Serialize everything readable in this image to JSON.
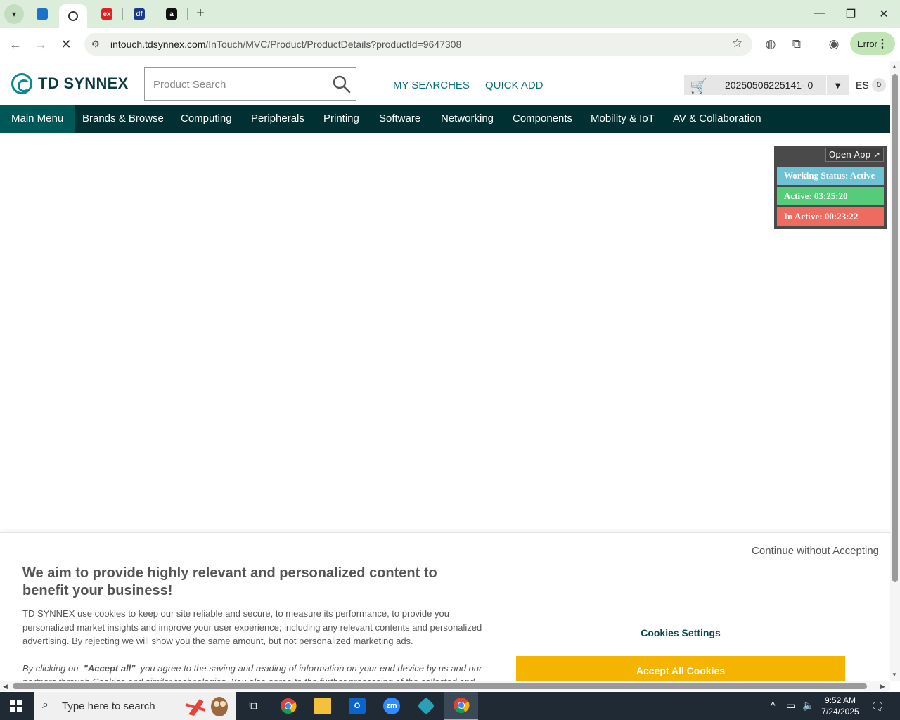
{
  "browser": {
    "tabs": [
      {
        "icon": "tab-favicon-blue",
        "color": "#1a73c9"
      },
      {
        "icon": "tab-favicon-tdsynnex",
        "color": "#3a3a3a",
        "active": true
      },
      {
        "icon": "tab-favicon-ex",
        "color": "#e02020",
        "text": "ex"
      },
      {
        "icon": "tab-favicon-df",
        "color": "#1a3a8a",
        "text": "df"
      },
      {
        "icon": "tab-favicon-amazon",
        "color": "#111111",
        "text": "a"
      }
    ],
    "url_host": "intouch.tdsynnex.com",
    "url_path": "/InTouch/MVC/Product/ProductDetails?productId=9647308",
    "error_label": "Error"
  },
  "header": {
    "logo_text": "TD SYNNEX",
    "search_placeholder": "Product Search",
    "my_searches": "MY SEARCHES",
    "quick_add": "QUICK ADD",
    "cart_label": "20250506225141- 0",
    "lang": "ES",
    "lang_count": "0"
  },
  "nav": {
    "items": [
      "Main Menu",
      "Brands & Browse",
      "Computing",
      "Peripherals",
      "Printing",
      "Software",
      "Networking",
      "Components",
      "Mobility & IoT",
      "AV & Collaboration"
    ]
  },
  "status_widget": {
    "open_app": "Open App ↗",
    "working_status": "Working Status: Active",
    "active": "Active: 03:25:20",
    "inactive": "In Active: 00:23:22",
    "colors": {
      "working": "#6cc3d5",
      "active": "#56cc7a",
      "inactive": "#ee6b5f"
    }
  },
  "cookie_banner": {
    "continue_without": "Continue without Accepting",
    "title": "We aim to provide highly relevant and personalized content to benefit your business!",
    "body": "TD SYNNEX use cookies to keep our site reliable and secure, to measure its performance, to provide you personalized market insights and improve your user experience; including any relevant contents and personalized advertising. By rejecting we will show you the same amount, but not personalized marketing ads.",
    "consent_prefix": "By clicking on",
    "consent_emph": "\"Accept all\"",
    "consent_rest": "you agree to the saving and reading of information on your end device by us and our partners through Cookies and similar technologies. You also agree to the further processing of the collected and",
    "settings_label": "Cookies Settings",
    "accept_label": "Accept All Cookies",
    "accent": "#f5b400"
  },
  "taskbar": {
    "search_placeholder": "Type here to search",
    "time": "9:52 AM",
    "date": "7/24/2025"
  }
}
